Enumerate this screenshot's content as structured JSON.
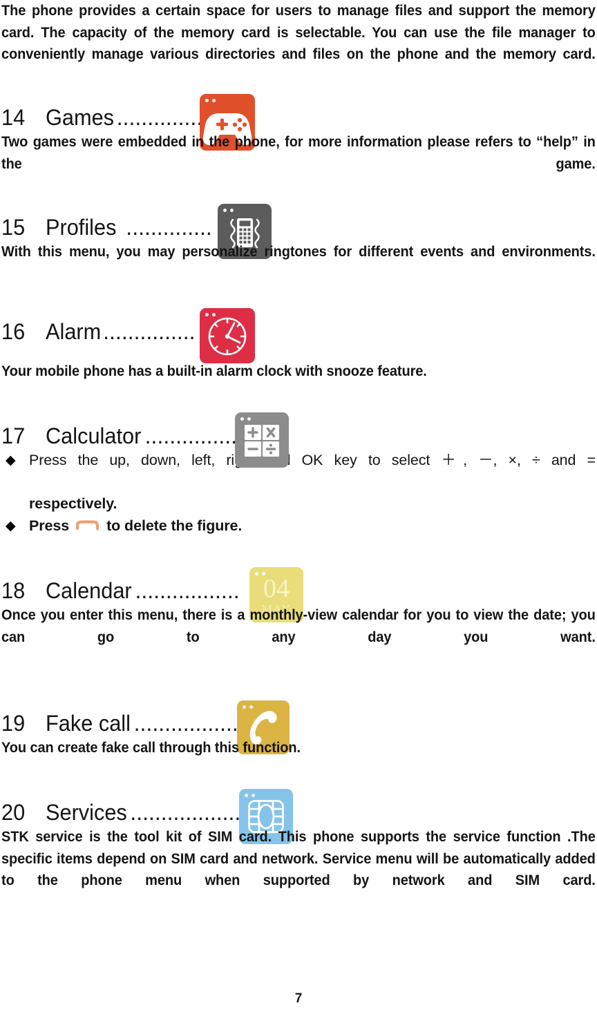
{
  "document": {
    "page_number": "7",
    "intro_paragraph": "The phone provides a certain space for users to manage files and support the memory card. The capacity of the memory card is selectable. You can use the file manager to conveniently manage various directories and files on the phone and the memory card."
  },
  "sections": [
    {
      "number": "14",
      "title": "Games",
      "leader": "..............",
      "icon": {
        "name": "games-icon",
        "glyph": "gamepad",
        "background": "#e0512b",
        "foreground": "#ffffff"
      },
      "body": "Two games were embedded in the phone, for more information please refers to “help” in the game."
    },
    {
      "number": "15",
      "title": "Profiles",
      "leader": "..............",
      "icon": {
        "name": "profiles-icon",
        "glyph": "vibrating-phone",
        "background": "#5c5c5c",
        "foreground": "#ffffff"
      },
      "body": "With this menu, you may personalize ringtones for different events and environments."
    },
    {
      "number": "16",
      "title": "Alarm",
      "leader": "...............",
      "icon": {
        "name": "alarm-icon",
        "glyph": "clock",
        "background": "#dd2e46",
        "foreground": "#ffffff"
      },
      "body": "Your mobile phone has a built-in alarm clock with snooze feature."
    },
    {
      "number": "17",
      "title": "Calculator",
      "leader": "...............",
      "icon": {
        "name": "calculator-icon",
        "glyph": "operator-keys",
        "background": "#8c8c8c",
        "foreground": "#ffffff",
        "keys": [
          "+",
          "×",
          "−",
          "÷"
        ]
      },
      "bullets": [
        {
          "line1": "Press the up, down, left, right and OK key to select ＋, －, ×, ÷ and =",
          "line2": "respectively."
        },
        {
          "before": "Press",
          "after": "to delete the figure.",
          "inline_icon": "clear-key-arc"
        }
      ]
    },
    {
      "number": "18",
      "title": "Calendar",
      "leader": ".................",
      "icon": {
        "name": "calendar-icon",
        "glyph": "date-card",
        "background": "#e8dd79",
        "foreground": "#f7f2c0",
        "day": "04",
        "month": "MAY"
      },
      "body": "Once you enter this menu, there is a monthly-view calendar for you to view the date; you can go to any day you want."
    },
    {
      "number": "19",
      "title": "Fake call",
      "leader": ".................",
      "icon": {
        "name": "fake-call-icon",
        "glyph": "handset",
        "background": "#dcb444",
        "foreground": "#ffffff"
      },
      "body": "You can create fake call through this function."
    },
    {
      "number": "20",
      "title": "Services",
      "leader": "..................",
      "icon": {
        "name": "services-icon",
        "glyph": "sim-chip",
        "background": "#85c3ea",
        "foreground": "#ffffff"
      },
      "body": "STK service is the tool kit of SIM card. This phone supports the service function .The specific items depend on SIM card and network. Service menu will be automatically added to the phone menu when supported by network and SIM card."
    }
  ]
}
